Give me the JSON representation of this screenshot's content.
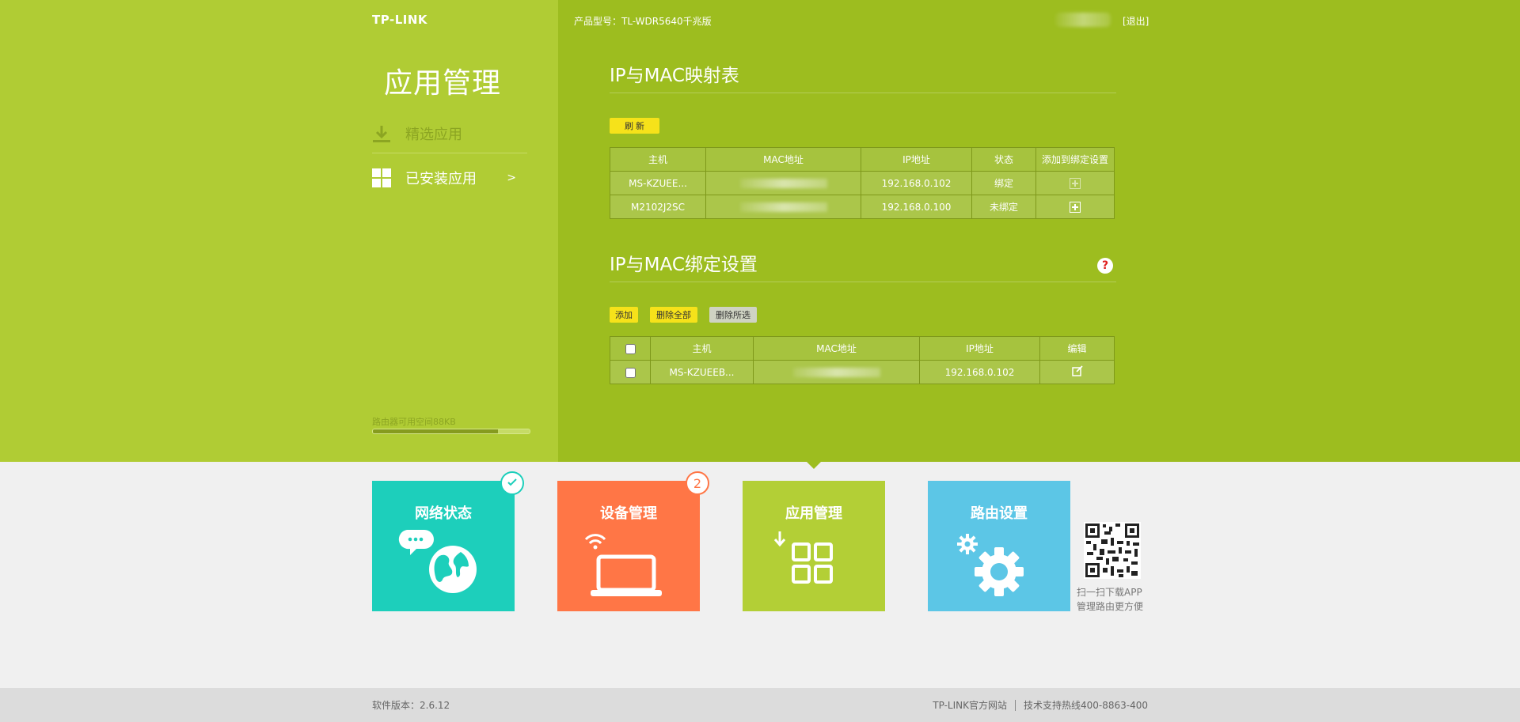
{
  "header": {
    "logo": "TP-LINK",
    "model_label": "产品型号：TL-WDR5640千兆版",
    "logout": "[退出]"
  },
  "sidebar": {
    "title": "应用管理",
    "items": [
      {
        "label": "精选应用",
        "icon": "download-icon",
        "active": false
      },
      {
        "label": "已安装应用",
        "icon": "grid-icon",
        "active": true,
        "arrow": ">"
      }
    ],
    "storage_label": "路由器可用空间88KB",
    "storage_used_fraction": 0.8
  },
  "mapping_section": {
    "title": "IP与MAC映射表",
    "refresh_button": "刷 新",
    "columns": [
      "主机",
      "MAC地址",
      "IP地址",
      "状态",
      "添加到绑定设置"
    ],
    "rows": [
      {
        "host": "MS-KZUEE...",
        "ip": "192.168.0.102",
        "status": "绑定"
      },
      {
        "host": "M2102J2SC",
        "ip": "192.168.0.100",
        "status": "未绑定"
      }
    ]
  },
  "binding_section": {
    "title": "IP与MAC绑定设置",
    "help": "?",
    "buttons": {
      "add": "添加",
      "delete_all": "删除全部",
      "delete_selected": "删除所选"
    },
    "columns": [
      "主机",
      "MAC地址",
      "IP地址",
      "编辑"
    ],
    "rows": [
      {
        "host": "MS-KZUEEB...",
        "ip": "192.168.0.102"
      }
    ]
  },
  "tiles": [
    {
      "label": "网络状态",
      "color": "#1dcfbb",
      "badge": "check"
    },
    {
      "label": "设备管理",
      "color": "#ff7646",
      "badge": "2"
    },
    {
      "label": "应用管理",
      "color": "#b3cf36"
    },
    {
      "label": "路由设置",
      "color": "#5cc6e6"
    }
  ],
  "qr": {
    "line1": "扫一扫下载APP",
    "line2": "管理路由更方便"
  },
  "footer": {
    "version": "软件版本：2.6.12",
    "site": "TP-LINK官方网站",
    "hotline": "技术支持热线400-8863-400"
  },
  "colors": {
    "sidebar_bg": "#b0cc34",
    "main_bg": "#9dbd1f",
    "button_yellow": "#f6e21a"
  }
}
